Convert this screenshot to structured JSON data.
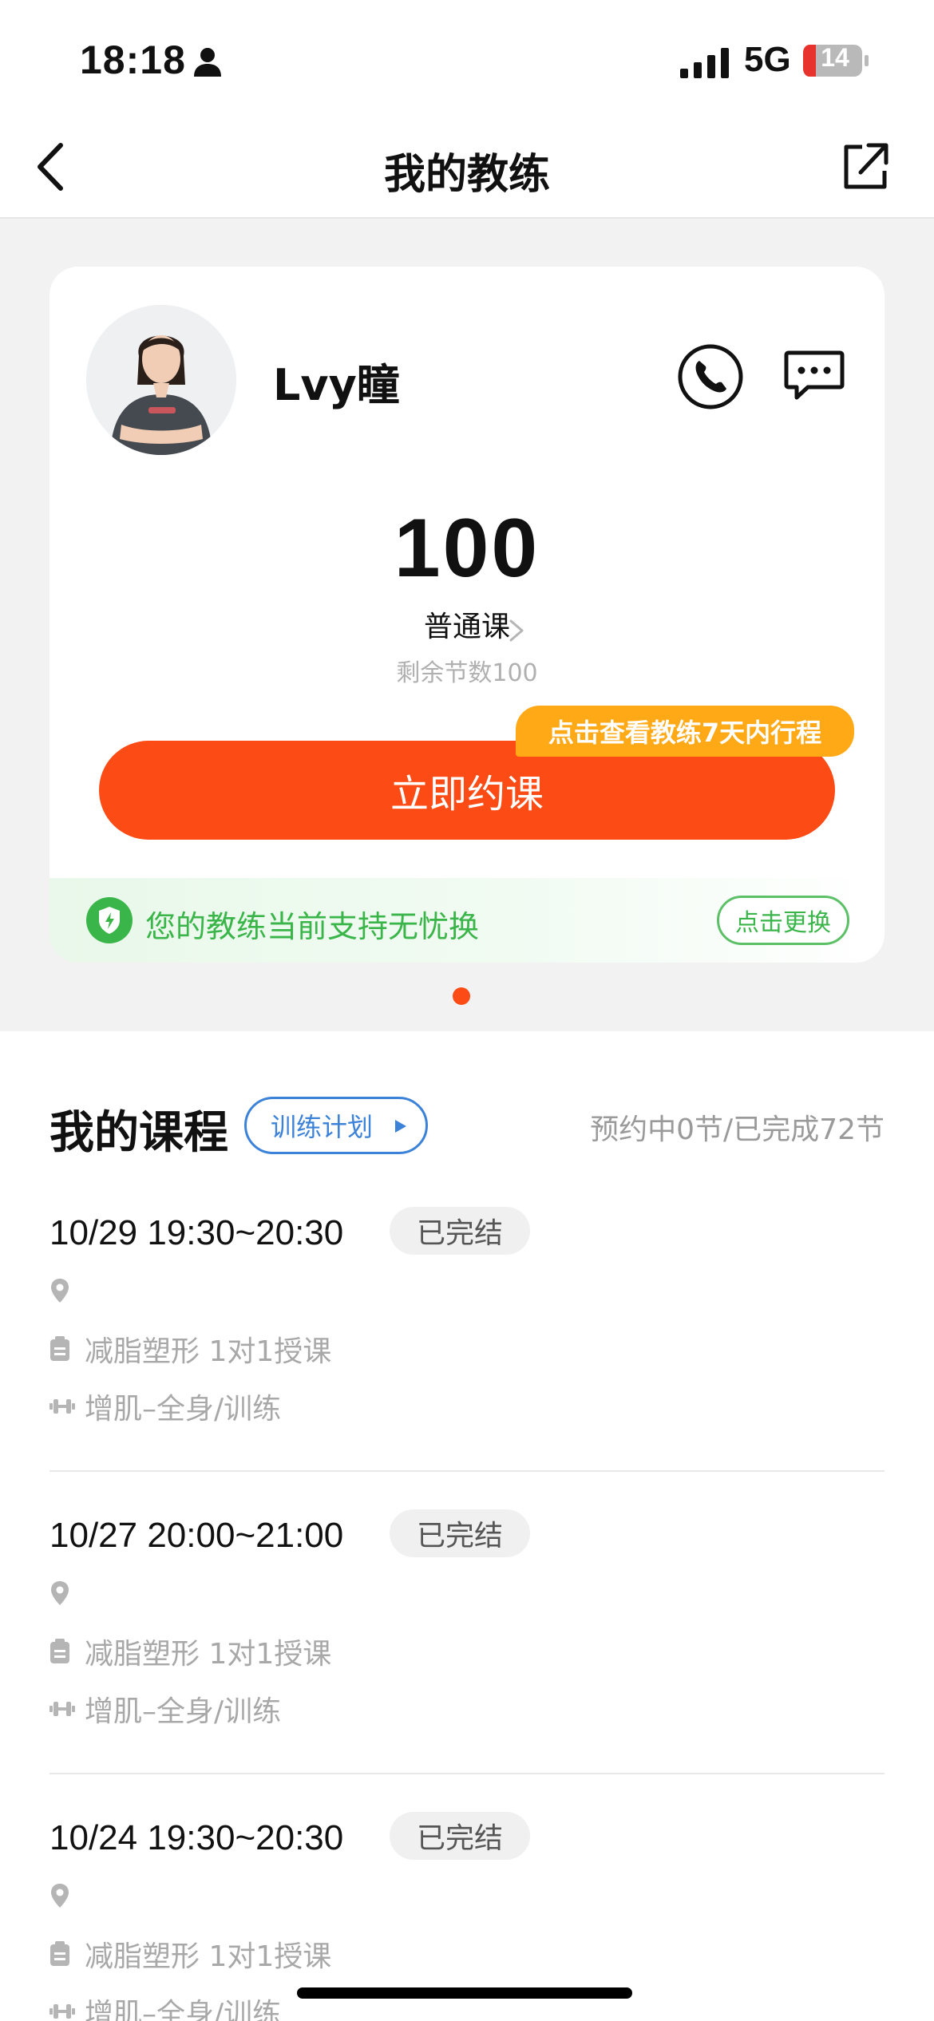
{
  "status_bar": {
    "time": "18:18",
    "network": "5G",
    "battery": "14"
  },
  "nav": {
    "title": "我的教练"
  },
  "coach": {
    "name": "Lvy瞳",
    "lesson_count": "100",
    "course_type": "普通课",
    "remaining": "剩余节数100",
    "schedule_tag": "点击查看教练7天内行程",
    "book_label": "立即约课",
    "guarantee_text": "您的教练当前支持无忧换",
    "switch_label": "点击更换"
  },
  "courses": {
    "title": "我的课程",
    "plan_label": "训练计划",
    "summary": "预约中0节/已完成72节",
    "items": [
      {
        "time": "10/29 19:30~20:30",
        "status": "已完结",
        "location": "",
        "class": "减脂塑形 1对1授课",
        "training": "增肌–全身/训练"
      },
      {
        "time": "10/27 20:00~21:00",
        "status": "已完结",
        "location": "",
        "class": "减脂塑形 1对1授课",
        "training": "增肌–全身/训练"
      },
      {
        "time": "10/24 19:30~20:30",
        "status": "已完结",
        "location": "",
        "class": "减脂塑形 1对1授课",
        "training": "增肌–全身/训练"
      }
    ]
  },
  "colors": {
    "accent": "#fd4b15",
    "tag": "#ffa917",
    "green": "#3ab549",
    "link_blue": "#3b82d8"
  }
}
